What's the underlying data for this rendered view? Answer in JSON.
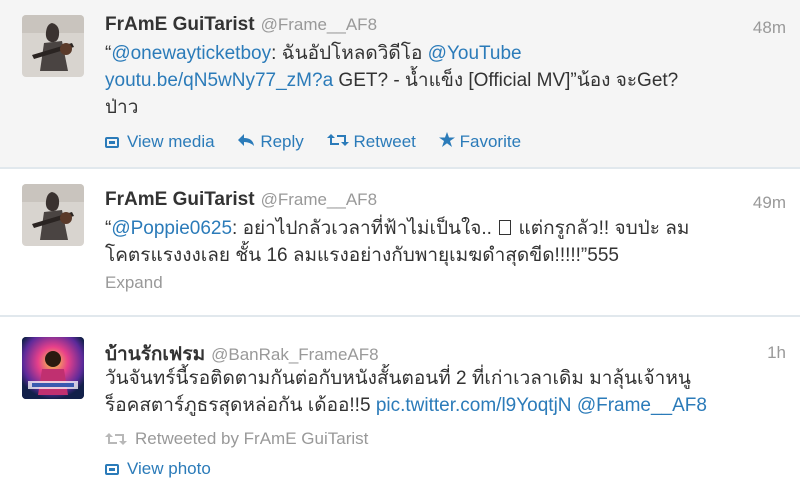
{
  "tweets": [
    {
      "fullname": "FrAmE GuiTarist",
      "username": "@Frame__AF8",
      "time": "48m",
      "text_parts": {
        "q": "“",
        "mention1": "@onewayticketboy",
        "t1": ": ฉันอัปโหลดวิดีโอ ",
        "mention2": "@YouTube",
        "link": "youtu.be/qN5wNy77_zM?a",
        "t2": " GET? - น้ำแข็ง [Official MV]”น้อง จะGet?",
        "t3": "ป่าว"
      },
      "actions": {
        "view_media": "View media",
        "reply": "Reply",
        "retweet": "Retweet",
        "favorite": "Favorite"
      }
    },
    {
      "fullname": "FrAmE GuiTarist",
      "username": "@Frame__AF8",
      "time": "49m",
      "text_parts": {
        "q": "“",
        "mention1": "@Poppie0625",
        "t1": ": อย่าไปกลัวเวลาที่ฟ้าไม่เป็นใจ..",
        "t2": "แต่กรูกลัว!! จบป่ะ ลม",
        "t3": "โคตรแรงงงเลย ชั้น 16 ลมแรงอย่างกับพายุเมฆดำสุดขีด!!!!!”555"
      },
      "expand": "Expand"
    },
    {
      "fullname": "บ้านรักเฟรม",
      "username": "@BanRak_FrameAF8",
      "time": "1h",
      "text_parts": {
        "t1": "วันจันทร์นี้รอติดตามกันต่อกับหนังสั้นตอนที่ 2 ที่เก่าเวลาเดิม มาลุ้นเจ้าหนู",
        "t2": "ร็อคสตาร์ภูธรสุดหล่อกัน เด้ออ!!5 ",
        "link": "pic.twitter.com/l9YoqtjN",
        "mention1": "@Frame__AF8"
      },
      "retweeted_by": "Retweeted by FrAmE GuiTarist",
      "view_photo": "View photo"
    }
  ],
  "colors": {
    "link": "#2b7bb9",
    "meta": "#999999",
    "text": "#333333",
    "highlight_bg": "#f5f5f5"
  },
  "icons": {
    "media": "media-icon",
    "reply": "reply-icon",
    "retweet": "retweet-icon",
    "favorite": "star-icon"
  }
}
